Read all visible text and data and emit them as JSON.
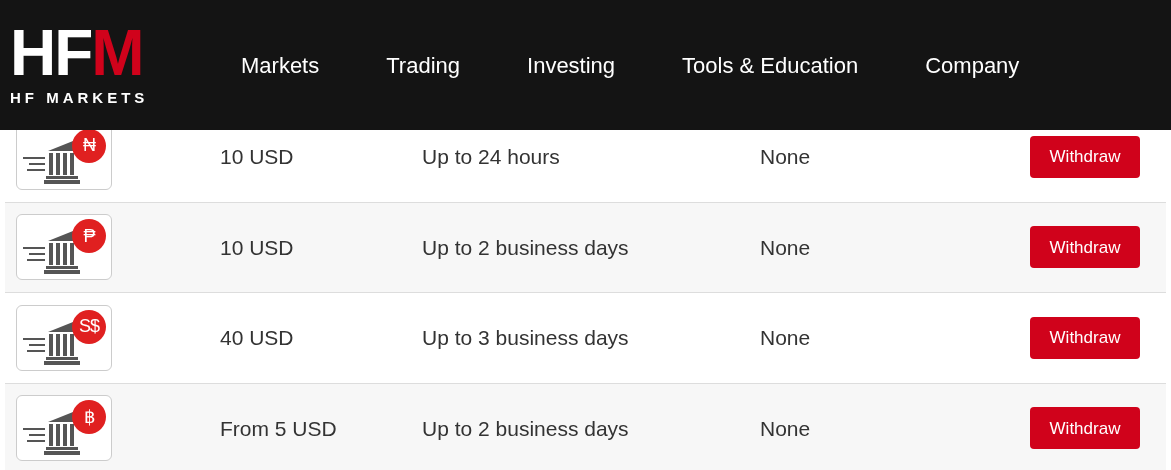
{
  "logo": {
    "mark": "HFM",
    "name": "HF MARKETS"
  },
  "nav": [
    "Markets",
    "Trading",
    "Investing",
    "Tools & Education",
    "Company"
  ],
  "rows": [
    {
      "currency": "₦",
      "minimum": "10 USD",
      "time": "Up to 24 hours",
      "fee": "None",
      "button": "Withdraw"
    },
    {
      "currency": "₱",
      "minimum": "10 USD",
      "time": "Up to 2 business days",
      "fee": "None",
      "button": "Withdraw"
    },
    {
      "currency": "S$",
      "minimum": "40 USD",
      "time": "Up to 3 business days",
      "fee": "None",
      "button": "Withdraw"
    },
    {
      "currency": "฿",
      "minimum": "From 5 USD",
      "time": "Up to 2 business days",
      "fee": "None",
      "button": "Withdraw"
    }
  ]
}
